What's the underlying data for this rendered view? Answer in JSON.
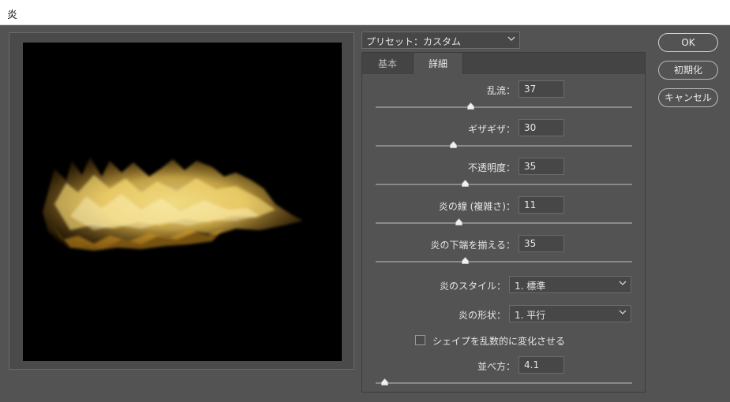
{
  "window": {
    "title": "炎"
  },
  "preset": {
    "value": "プリセット：カスタム"
  },
  "tabs": [
    {
      "label": "基本"
    },
    {
      "label": "詳細"
    }
  ],
  "params": [
    {
      "label": "乱流：",
      "value": "37"
    },
    {
      "label": "ギザギザ：",
      "value": "30"
    },
    {
      "label": "不透明度：",
      "value": "35"
    },
    {
      "label": "炎の線 (複雑さ)：",
      "value": "11"
    },
    {
      "label": "炎の下端を揃える：",
      "value": "35"
    }
  ],
  "style": {
    "label": "炎のスタイル：",
    "value": "1. 標準"
  },
  "shape": {
    "label": "炎の形状：",
    "value": "1. 平行"
  },
  "randomize": {
    "label": "シェイプを乱数的に変化させる",
    "checked": false
  },
  "arrangement": {
    "label": "並べ方：",
    "value": "4.1"
  },
  "buttons": {
    "ok": "OK",
    "reset": "初期化",
    "cancel": "キャンセル"
  },
  "colors": {
    "background": "#535353",
    "flame_core": "#ffe27a",
    "flame_edge": "#c98a1e"
  }
}
